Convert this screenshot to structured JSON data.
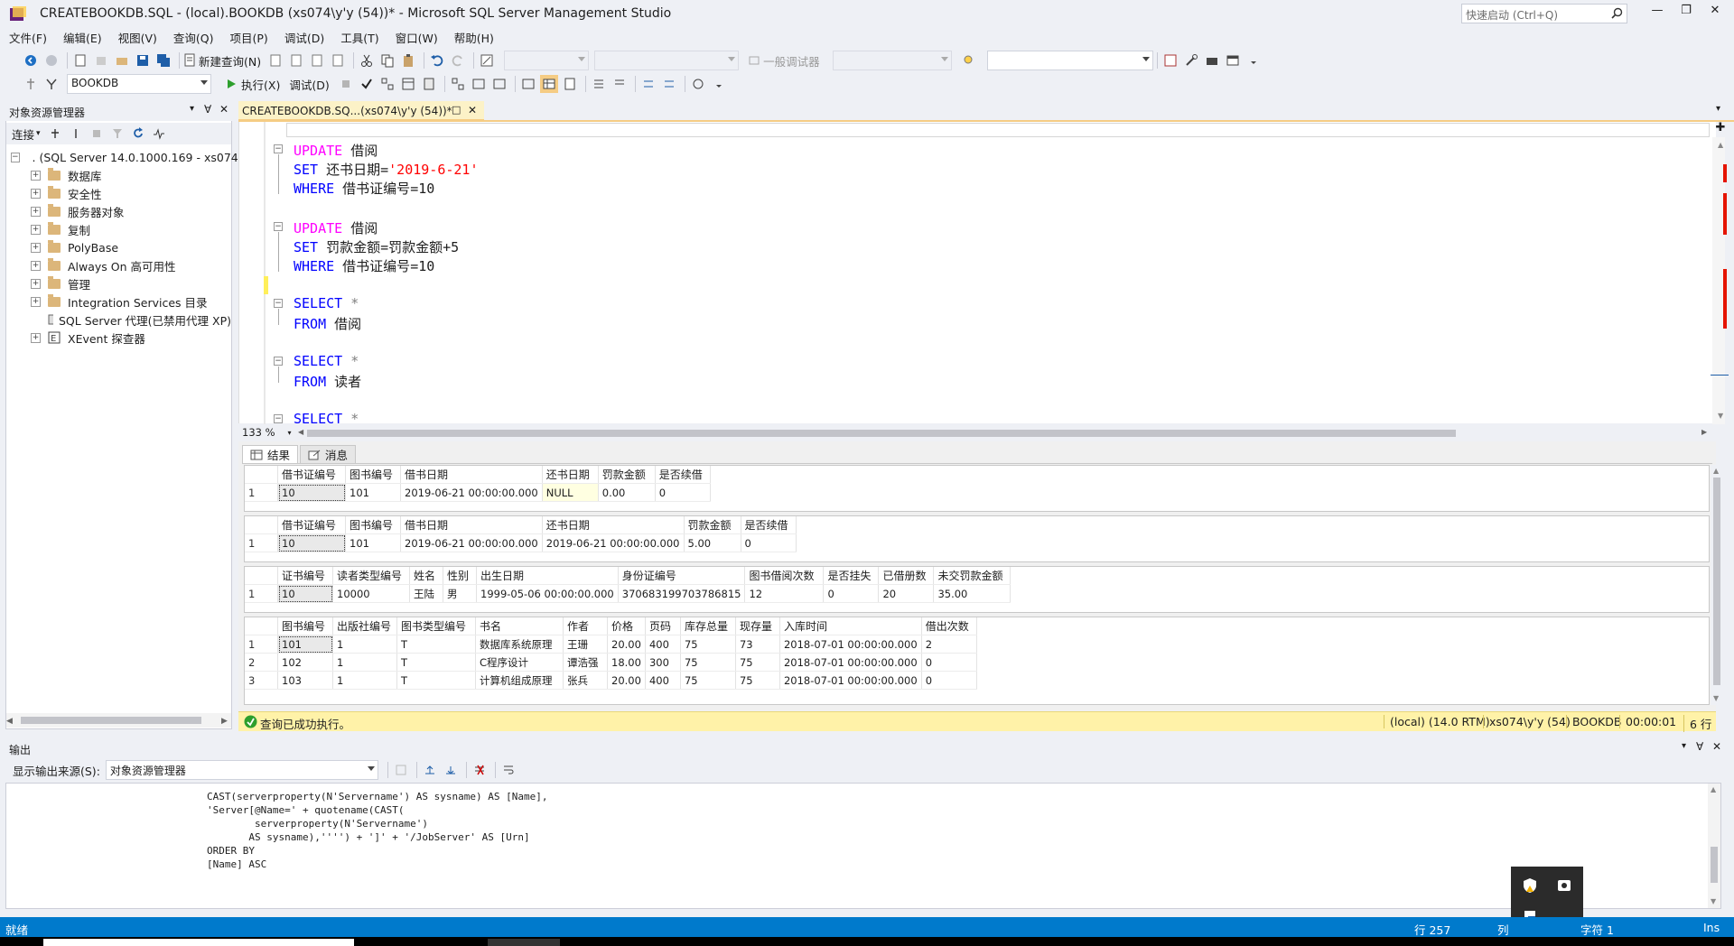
{
  "window": {
    "title": "CREATEBOOKDB.SQL - (local).BOOKDB (xs074\\y'y (54))* - Microsoft SQL Server Management Studio",
    "quick_launch_placeholder": "快速启动 (Ctrl+Q)"
  },
  "menu": [
    "文件(F)",
    "编辑(E)",
    "视图(V)",
    "查询(Q)",
    "项目(P)",
    "调试(D)",
    "工具(T)",
    "窗口(W)",
    "帮助(H)"
  ],
  "toolbar1": {
    "new_query": "新建查询(N)",
    "debugger_label": "一般调试器"
  },
  "toolbar2": {
    "database": "BOOKDB",
    "execute": "执行(X)",
    "debug": "调试(D)"
  },
  "object_explorer": {
    "title": "对象资源管理器",
    "connect_label": "连接",
    "root": ". (SQL Server 14.0.1000.169 - xs074",
    "nodes": [
      "数据库",
      "安全性",
      "服务器对象",
      "复制",
      "PolyBase",
      "Always On 高可用性",
      "管理",
      "Integration Services 目录",
      "SQL Server 代理(已禁用代理 XP)",
      "XEvent 探查器"
    ]
  },
  "document_tab": "CREATEBOOKDB.SQ...(xs074\\y'y (54))*",
  "editor": {
    "zoom": "133 %",
    "lines": [
      {
        "a": "UPDATE",
        "b": " 借阅"
      },
      {
        "a": "SET",
        "b": " 还书日期=",
        "c": "'2019-6-21'"
      },
      {
        "a": "WHERE",
        "b": " 借书证编号=10"
      },
      {
        "a": "UPDATE",
        "b": " 借阅"
      },
      {
        "a": "SET",
        "b": " 罚款金额=罚款金额+5"
      },
      {
        "a": "WHERE",
        "b": " 借书证编号=10"
      },
      {
        "a": "SELECT",
        "b": " *"
      },
      {
        "a": "FROM",
        "b": " 借阅"
      },
      {
        "a": "SELECT",
        "b": " *"
      },
      {
        "a": "FROM",
        "b": " 读者"
      },
      {
        "a": "SELECT",
        "b": " *"
      }
    ]
  },
  "results_tabs": [
    "结果",
    "消息"
  ],
  "grid1": {
    "headers": [
      "借书证编号",
      "图书编号",
      "借书日期",
      "还书日期",
      "罚款金额",
      "是否续借"
    ],
    "rows": [
      [
        "1",
        "10",
        "101",
        "2019-06-21 00:00:00.000",
        "NULL",
        "0.00",
        "0"
      ]
    ]
  },
  "grid2": {
    "headers": [
      "借书证编号",
      "图书编号",
      "借书日期",
      "还书日期",
      "罚款金额",
      "是否续借"
    ],
    "rows": [
      [
        "1",
        "10",
        "101",
        "2019-06-21 00:00:00.000",
        "2019-06-21 00:00:00.000",
        "5.00",
        "0"
      ]
    ]
  },
  "grid3": {
    "headers": [
      "证书编号",
      "读者类型编号",
      "姓名",
      "性别",
      "出生日期",
      "身份证编号",
      "图书借阅次数",
      "是否挂失",
      "已借册数",
      "未交罚款金额"
    ],
    "rows": [
      [
        "1",
        "10",
        "10000",
        "王陆",
        "男",
        "1999-05-06 00:00:00.000",
        "370683199703786815",
        "12",
        "0",
        "20",
        "35.00"
      ]
    ]
  },
  "grid4": {
    "headers": [
      "图书编号",
      "出版社编号",
      "图书类型编号",
      "书名",
      "作者",
      "价格",
      "页码",
      "库存总量",
      "现存量",
      "入库时间",
      "借出次数"
    ],
    "rows": [
      [
        "1",
        "101",
        "1",
        "T",
        "数据库系统原理",
        "王珊",
        "20.00",
        "400",
        "75",
        "73",
        "2018-07-01 00:00:00.000",
        "2"
      ],
      [
        "2",
        "102",
        "1",
        "T",
        "C程序设计",
        "谭浩强",
        "18.00",
        "300",
        "75",
        "75",
        "2018-07-01 00:00:00.000",
        "0"
      ],
      [
        "3",
        "103",
        "1",
        "T",
        "计算机组成原理",
        "张兵",
        "20.00",
        "400",
        "75",
        "75",
        "2018-07-01 00:00:00.000",
        "0"
      ]
    ]
  },
  "query_status": {
    "message": "查询已成功执行。",
    "server": "(local) (14.0 RTM)",
    "user": "xs074\\y'y (54)",
    "database": "BOOKDB",
    "elapsed": "00:00:01",
    "rows": "6 行"
  },
  "output": {
    "title": "输出",
    "source_label": "显示输出来源(S):",
    "source_value": "对象资源管理器",
    "lines": [
      "CAST(serverproperty(N'Servername') AS sysname) AS [Name],",
      "'Server[@Name=' + quotename(CAST(",
      "        serverproperty(N'Servername')",
      "       AS sysname),'''') + ']' + '/JobServer' AS [Urn]",
      "ORDER BY",
      "[Name] ASC"
    ]
  },
  "statusbar": {
    "ready": "就绪",
    "line": "行 257",
    "col": "列",
    "char": "字符 1",
    "mode": "Ins"
  },
  "colors": {
    "status_blue": "#007acc",
    "query_status_yellow": "#fff2a8",
    "keyword_pink": "#ff00ff",
    "keyword_blue": "#0000ff",
    "string_red": "#ff0000"
  }
}
